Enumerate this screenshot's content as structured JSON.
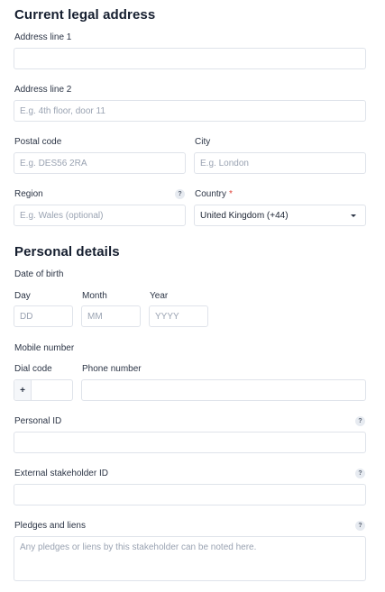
{
  "address": {
    "title": "Current legal address",
    "line1": {
      "label": "Address line 1",
      "placeholder": ""
    },
    "line2": {
      "label": "Address line 2",
      "placeholder": "E.g. 4th floor, door 11"
    },
    "postal": {
      "label": "Postal code",
      "placeholder": "E.g. DES56 2RA"
    },
    "city": {
      "label": "City",
      "placeholder": "E.g. London"
    },
    "region": {
      "label": "Region",
      "placeholder": "E.g. Wales (optional)",
      "help": "?"
    },
    "country": {
      "label": "Country",
      "required_mark": "*",
      "value": "United Kingdom (+44)"
    }
  },
  "personal": {
    "title": "Personal details",
    "dob": {
      "label": "Date of birth",
      "day": {
        "label": "Day",
        "placeholder": "DD"
      },
      "month": {
        "label": "Month",
        "placeholder": "MM"
      },
      "year": {
        "label": "Year",
        "placeholder": "YYYY"
      }
    },
    "mobile": {
      "label": "Mobile number",
      "dial": {
        "label": "Dial code",
        "prefix": "+"
      },
      "phone": {
        "label": "Phone number"
      }
    },
    "personal_id": {
      "label": "Personal ID",
      "help": "?"
    },
    "external_id": {
      "label": "External stakeholder ID",
      "help": "?"
    },
    "pledges": {
      "label": "Pledges and liens",
      "help": "?",
      "placeholder": "Any pledges or liens by this stakeholder can be noted here."
    }
  }
}
